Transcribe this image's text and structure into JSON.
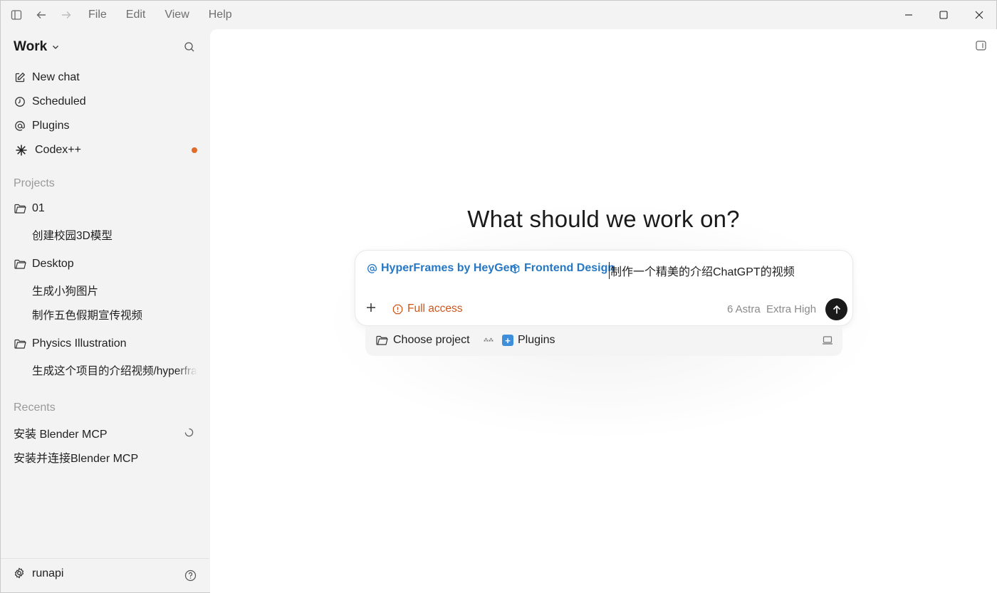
{
  "titlebar": {
    "menu": [
      "File",
      "Edit",
      "View",
      "Help"
    ]
  },
  "sidebar": {
    "workspace": "Work",
    "nav": [
      {
        "label": "New chat",
        "icon": "edit-icon"
      },
      {
        "label": "Scheduled",
        "icon": "clock-icon"
      },
      {
        "label": "Plugins",
        "icon": "at-icon"
      },
      {
        "label": "Codex++",
        "icon": "asterisk-icon"
      }
    ],
    "projects_heading": "Projects",
    "projects": [
      {
        "name": "01",
        "items": [
          "创建校园3D模型"
        ]
      },
      {
        "name": "Desktop",
        "items": [
          "生成小狗图片",
          "制作五色假期宣传视频"
        ]
      },
      {
        "name": "Physics Illustration",
        "items": [
          "生成这个项目的介绍视频/hyperframes"
        ]
      }
    ],
    "recents_heading": "Recents",
    "recents": [
      "安装 Blender MCP",
      "安装并连接Blender MCP"
    ],
    "user": "runapi",
    "accent": "#e06c2b"
  },
  "main": {
    "headline": "What should we work on?",
    "composer": {
      "chips": [
        "HyperFrames by HeyGen",
        "Frontend Design"
      ],
      "prompt": "制作一个精美的介绍ChatGPT的视频",
      "access": "Full access",
      "model": "6 Astra",
      "effort": "Extra High"
    },
    "subbar": {
      "project": "Choose project",
      "plugins": "Plugins"
    },
    "colors": {
      "chip": "#2778c4",
      "warning": "#d0551b"
    }
  }
}
